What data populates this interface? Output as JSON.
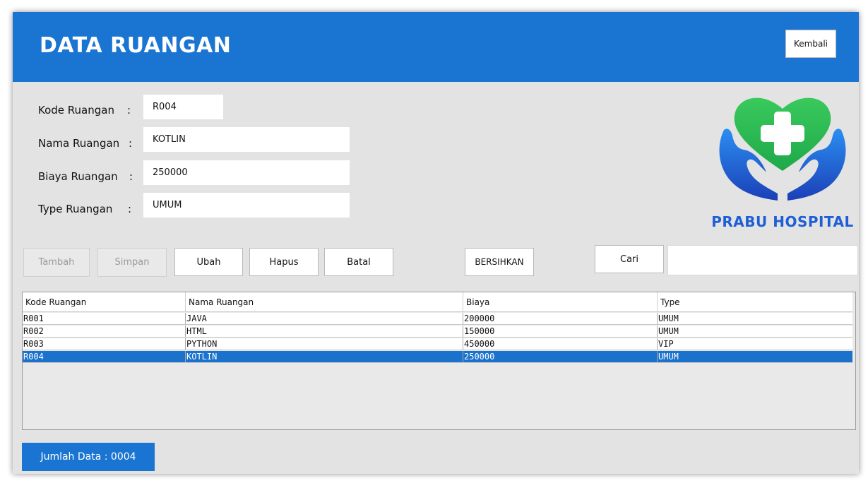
{
  "header": {
    "title": "DATA RUANGAN",
    "back_label": "Kembali"
  },
  "form": {
    "separator": ":",
    "fields": [
      {
        "label": "Kode Ruangan",
        "value": "R004"
      },
      {
        "label": "Nama Ruangan",
        "value": "KOTLIN"
      },
      {
        "label": "Biaya Ruangan",
        "value": "250000"
      },
      {
        "label": "Type Ruangan",
        "value": "UMUM"
      }
    ]
  },
  "actions": {
    "tambah": "Tambah",
    "simpan": "Simpan",
    "ubah": "Ubah",
    "hapus": "Hapus",
    "batal": "Batal",
    "bersihkan": "BERSIHKAN",
    "cari": "Cari",
    "search_value": ""
  },
  "logo": {
    "text": "PRABU HOSPITAL",
    "icon": "heart-cross-hands-icon",
    "colors": {
      "heart": "#2bbd55",
      "hands": "#1f5fd6"
    }
  },
  "table": {
    "columns": [
      "Kode Ruangan",
      "Nama Ruangan",
      "Biaya",
      "Type"
    ],
    "rows": [
      [
        "R001",
        "JAVA",
        "200000",
        "UMUM"
      ],
      [
        "R002",
        "HTML",
        "150000",
        "UMUM"
      ],
      [
        "R003",
        "PYTHON",
        "450000",
        "VIP"
      ],
      [
        "R004",
        "KOTLIN",
        "250000",
        "UMUM"
      ]
    ],
    "selected_row": 3
  },
  "footer": {
    "count_text": "Jumlah Data  :  0004"
  },
  "colors": {
    "accent": "#1a75d2",
    "background": "#e3e3e3",
    "selected_row": "#1a72cc"
  }
}
